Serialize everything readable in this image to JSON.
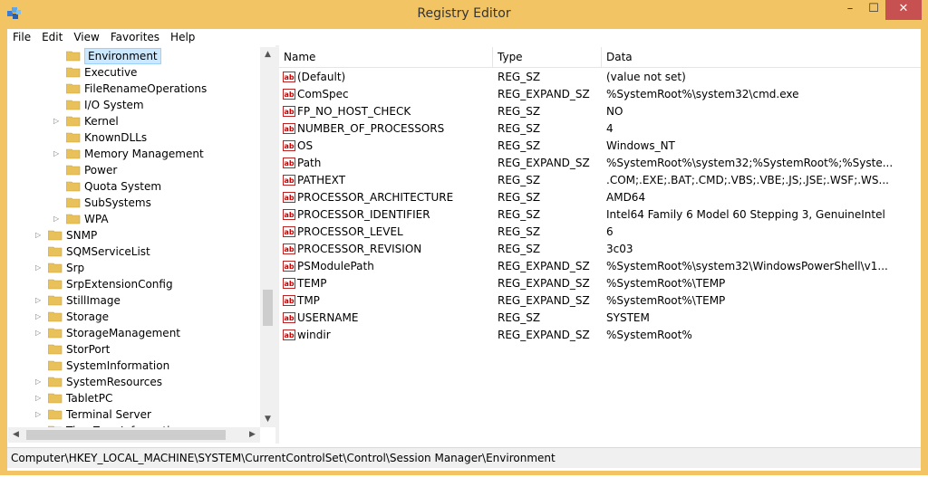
{
  "window": {
    "title": "Registry Editor",
    "minimize": "–",
    "maximize": "☐",
    "close": "✕"
  },
  "menu": [
    "File",
    "Edit",
    "View",
    "Favorites",
    "Help"
  ],
  "tree": {
    "items": [
      {
        "label": "Environment",
        "expander": "",
        "selected": true
      },
      {
        "label": "Executive",
        "expander": ""
      },
      {
        "label": "FileRenameOperations",
        "expander": ""
      },
      {
        "label": "I/O System",
        "expander": ""
      },
      {
        "label": "Kernel",
        "expander": "▷"
      },
      {
        "label": "KnownDLLs",
        "expander": ""
      },
      {
        "label": "Memory Management",
        "expander": "▷"
      },
      {
        "label": "Power",
        "expander": ""
      },
      {
        "label": "Quota System",
        "expander": ""
      },
      {
        "label": "SubSystems",
        "expander": ""
      },
      {
        "label": "WPA",
        "expander": "▷"
      },
      {
        "label": "SNMP",
        "expander": "▷"
      },
      {
        "label": "SQMServiceList",
        "expander": ""
      },
      {
        "label": "Srp",
        "expander": "▷"
      },
      {
        "label": "SrpExtensionConfig",
        "expander": ""
      },
      {
        "label": "StillImage",
        "expander": "▷"
      },
      {
        "label": "Storage",
        "expander": "▷"
      },
      {
        "label": "StorageManagement",
        "expander": "▷"
      },
      {
        "label": "StorPort",
        "expander": ""
      },
      {
        "label": "SystemInformation",
        "expander": ""
      },
      {
        "label": "SystemResources",
        "expander": "▷"
      },
      {
        "label": "TabletPC",
        "expander": "▷"
      },
      {
        "label": "Terminal Server",
        "expander": "▷"
      },
      {
        "label": "TimeZoneInformation",
        "expander": ""
      }
    ]
  },
  "list": {
    "headers": {
      "name": "Name",
      "type": "Type",
      "data": "Data"
    },
    "rows": [
      {
        "name": "(Default)",
        "type": "REG_SZ",
        "data": "(value not set)"
      },
      {
        "name": "ComSpec",
        "type": "REG_EXPAND_SZ",
        "data": "%SystemRoot%\\system32\\cmd.exe"
      },
      {
        "name": "FP_NO_HOST_CHECK",
        "type": "REG_SZ",
        "data": "NO"
      },
      {
        "name": "NUMBER_OF_PROCESSORS",
        "type": "REG_SZ",
        "data": "4"
      },
      {
        "name": "OS",
        "type": "REG_SZ",
        "data": "Windows_NT"
      },
      {
        "name": "Path",
        "type": "REG_EXPAND_SZ",
        "data": "%SystemRoot%\\system32;%SystemRoot%;%Syste..."
      },
      {
        "name": "PATHEXT",
        "type": "REG_SZ",
        "data": ".COM;.EXE;.BAT;.CMD;.VBS;.VBE;.JS;.JSE;.WSF;.WS..."
      },
      {
        "name": "PROCESSOR_ARCHITECTURE",
        "type": "REG_SZ",
        "data": "AMD64"
      },
      {
        "name": "PROCESSOR_IDENTIFIER",
        "type": "REG_SZ",
        "data": "Intel64 Family 6 Model 60 Stepping 3, GenuineIntel"
      },
      {
        "name": "PROCESSOR_LEVEL",
        "type": "REG_SZ",
        "data": "6"
      },
      {
        "name": "PROCESSOR_REVISION",
        "type": "REG_SZ",
        "data": "3c03"
      },
      {
        "name": "PSModulePath",
        "type": "REG_EXPAND_SZ",
        "data": "%SystemRoot%\\system32\\WindowsPowerShell\\v1..."
      },
      {
        "name": "TEMP",
        "type": "REG_EXPAND_SZ",
        "data": "%SystemRoot%\\TEMP"
      },
      {
        "name": "TMP",
        "type": "REG_EXPAND_SZ",
        "data": "%SystemRoot%\\TEMP"
      },
      {
        "name": "USERNAME",
        "type": "REG_SZ",
        "data": "SYSTEM"
      },
      {
        "name": "windir",
        "type": "REG_EXPAND_SZ",
        "data": "%SystemRoot%"
      }
    ],
    "value_icon_text": "ab"
  },
  "statusbar": {
    "path": "Computer\\HKEY_LOCAL_MACHINE\\SYSTEM\\CurrentControlSet\\Control\\Session Manager\\Environment"
  },
  "colors": {
    "titlebar": "#f2c463",
    "close_button": "#c75050",
    "selection": "#cce8ff",
    "folder": "#e8c15a"
  },
  "icons": {
    "app": "registry-editor-icon",
    "folder": "folder-icon",
    "value": "string-value-icon"
  }
}
